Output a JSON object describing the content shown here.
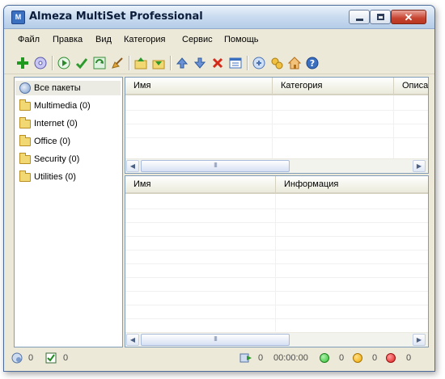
{
  "window": {
    "title": "Almeza MultiSet Professional",
    "app_icon_letter": "M",
    "controls": {
      "minimize": "minimize-icon",
      "maximize": "maximize-icon",
      "close": "✕"
    }
  },
  "menu": [
    "Файл",
    "Правка",
    "Вид",
    "Категория",
    "Сервис",
    "Помощь"
  ],
  "toolbar": {
    "buttons": [
      "add-icon",
      "disc-icon",
      "play-icon",
      "check-icon",
      "refresh-icon",
      "broom-icon",
      "export-icon",
      "import-icon",
      "move-up-icon",
      "move-down-icon",
      "delete-icon",
      "properties-icon",
      "options-icon",
      "gears-icon",
      "home-icon",
      "help-icon"
    ]
  },
  "tree": {
    "items": [
      {
        "label": "Все пакеты",
        "icon": "packages-icon"
      },
      {
        "label": "Multimedia (0)",
        "icon": "folder-icon"
      },
      {
        "label": "Internet (0)",
        "icon": "folder-icon"
      },
      {
        "label": "Office (0)",
        "icon": "folder-icon"
      },
      {
        "label": "Security (0)",
        "icon": "folder-icon"
      },
      {
        "label": "Utilities (0)",
        "icon": "folder-icon"
      }
    ]
  },
  "packages_table": {
    "columns": [
      "Имя",
      "Категория",
      "Описа"
    ]
  },
  "details_table": {
    "columns": [
      "Имя",
      "Информация"
    ]
  },
  "scrollbar": {
    "thumb_grip": "III",
    "left_arrow": "◀",
    "right_arrow": "▶"
  },
  "status": {
    "packages_count": "0",
    "checked_count": "0",
    "queue_count": "0",
    "elapsed": "00:00:00",
    "success_count": "0",
    "warning_count": "0",
    "error_count": "0",
    "colors": {
      "success": "#2fbf2f",
      "warning": "#f2a900",
      "error": "#e02020"
    }
  }
}
